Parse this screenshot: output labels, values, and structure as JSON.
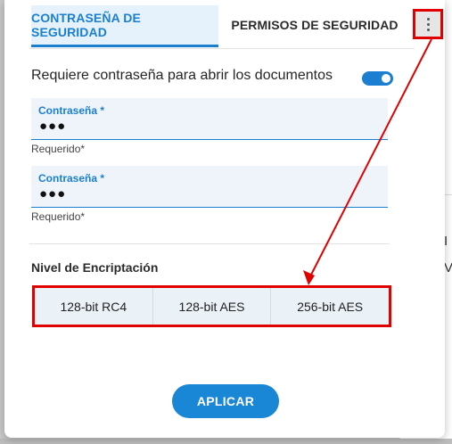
{
  "tabs": [
    {
      "label": "CONTRASEÑA DE SEGURIDAD",
      "active": true
    },
    {
      "label": "PERMISOS DE SEGURIDAD",
      "active": false
    }
  ],
  "more_button_icon": "more-vertical-icon",
  "require_password": {
    "label": "Requiere contraseña para abrir los documentos",
    "enabled": true
  },
  "fields": [
    {
      "label": "Contraseña *",
      "value": "●●●",
      "hint": "Requerido*"
    },
    {
      "label": "Contraseña *",
      "value": "●●●",
      "hint": "Requerido*"
    }
  ],
  "encryption": {
    "title": "Nivel de Encriptación",
    "options": [
      "128-bit RC4",
      "128-bit AES",
      "256-bit AES"
    ]
  },
  "apply_label": "APLICAR",
  "background_fragments": [
    "I",
    "V"
  ],
  "colors": {
    "accent": "#1a7fd1",
    "annotation": "#e00000"
  }
}
